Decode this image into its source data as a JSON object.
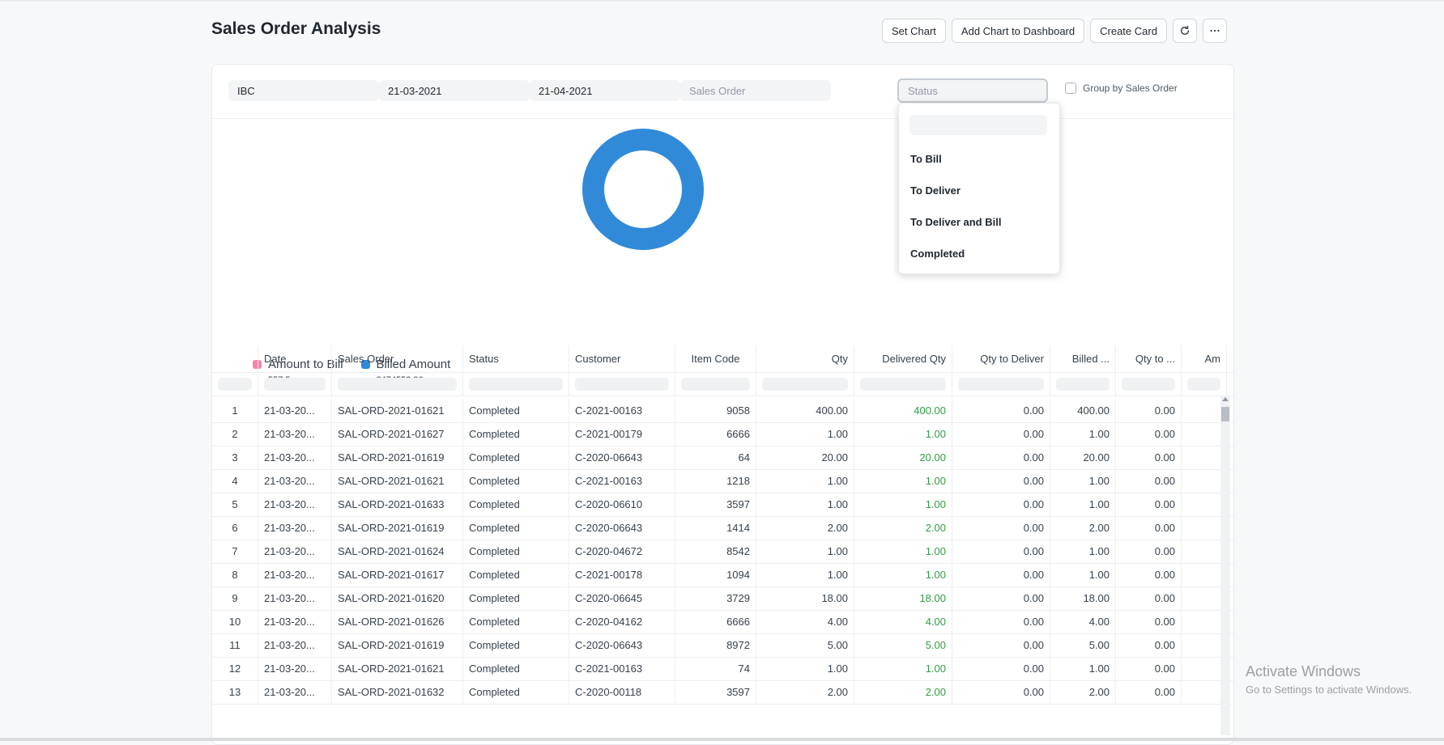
{
  "page": {
    "title": "Sales Order Analysis"
  },
  "toolbar": {
    "set_chart": "Set Chart",
    "add_chart": "Add Chart to Dashboard",
    "create_card": "Create Card"
  },
  "filters": {
    "company": "IBC",
    "from_date": "21-03-2021",
    "to_date": "21-04-2021",
    "sales_order_placeholder": "Sales Order",
    "status_placeholder": "Status",
    "group_by_label": "Group by Sales Order"
  },
  "status_dropdown": {
    "options": [
      "To Bill",
      "To Deliver",
      "To Deliver and Bill",
      "Completed"
    ]
  },
  "chart_data": {
    "type": "pie",
    "donut": true,
    "series": [
      {
        "name": "Amount to Bill",
        "value": 557.5,
        "label": "557.5",
        "color": "#f683ae"
      },
      {
        "name": "Billed Amount",
        "value": 8474553.36,
        "label": "8474553.36",
        "color": "#318ad8"
      }
    ]
  },
  "table": {
    "columns": [
      "Date",
      "Sales Order",
      "Status",
      "Customer",
      "Item Code",
      "Qty",
      "Delivered Qty",
      "Qty to Deliver",
      "Billed ...",
      "Qty to ...",
      "Am"
    ],
    "rows": [
      [
        "1",
        "21-03-20...",
        "SAL-ORD-2021-01621",
        "Completed",
        "C-2021-00163",
        "9058",
        "400.00",
        "400.00",
        "0.00",
        "400.00",
        "0.00"
      ],
      [
        "2",
        "21-03-20...",
        "SAL-ORD-2021-01627",
        "Completed",
        "C-2021-00179",
        "6666",
        "1.00",
        "1.00",
        "0.00",
        "1.00",
        "0.00"
      ],
      [
        "3",
        "21-03-20...",
        "SAL-ORD-2021-01619",
        "Completed",
        "C-2020-06643",
        "64",
        "20.00",
        "20.00",
        "0.00",
        "20.00",
        "0.00"
      ],
      [
        "4",
        "21-03-20...",
        "SAL-ORD-2021-01621",
        "Completed",
        "C-2021-00163",
        "1218",
        "1.00",
        "1.00",
        "0.00",
        "1.00",
        "0.00"
      ],
      [
        "5",
        "21-03-20...",
        "SAL-ORD-2021-01633",
        "Completed",
        "C-2020-06610",
        "3597",
        "1.00",
        "1.00",
        "0.00",
        "1.00",
        "0.00"
      ],
      [
        "6",
        "21-03-20...",
        "SAL-ORD-2021-01619",
        "Completed",
        "C-2020-06643",
        "1414",
        "2.00",
        "2.00",
        "0.00",
        "2.00",
        "0.00"
      ],
      [
        "7",
        "21-03-20...",
        "SAL-ORD-2021-01624",
        "Completed",
        "C-2020-04672",
        "8542",
        "1.00",
        "1.00",
        "0.00",
        "1.00",
        "0.00"
      ],
      [
        "8",
        "21-03-20...",
        "SAL-ORD-2021-01617",
        "Completed",
        "C-2021-00178",
        "1094",
        "1.00",
        "1.00",
        "0.00",
        "1.00",
        "0.00"
      ],
      [
        "9",
        "21-03-20...",
        "SAL-ORD-2021-01620",
        "Completed",
        "C-2020-06645",
        "3729",
        "18.00",
        "18.00",
        "0.00",
        "18.00",
        "0.00"
      ],
      [
        "10",
        "21-03-20...",
        "SAL-ORD-2021-01626",
        "Completed",
        "C-2020-04162",
        "6666",
        "4.00",
        "4.00",
        "0.00",
        "4.00",
        "0.00"
      ],
      [
        "11",
        "21-03-20...",
        "SAL-ORD-2021-01619",
        "Completed",
        "C-2020-06643",
        "8972",
        "5.00",
        "5.00",
        "0.00",
        "5.00",
        "0.00"
      ],
      [
        "12",
        "21-03-20...",
        "SAL-ORD-2021-01621",
        "Completed",
        "C-2021-00163",
        "74",
        "1.00",
        "1.00",
        "0.00",
        "1.00",
        "0.00"
      ],
      [
        "13",
        "21-03-20...",
        "SAL-ORD-2021-01632",
        "Completed",
        "C-2020-00118",
        "3597",
        "2.00",
        "2.00",
        "0.00",
        "2.00",
        "0.00"
      ]
    ]
  },
  "watermark": {
    "line1": "Activate Windows",
    "line2": "Go to Settings to activate Windows."
  }
}
